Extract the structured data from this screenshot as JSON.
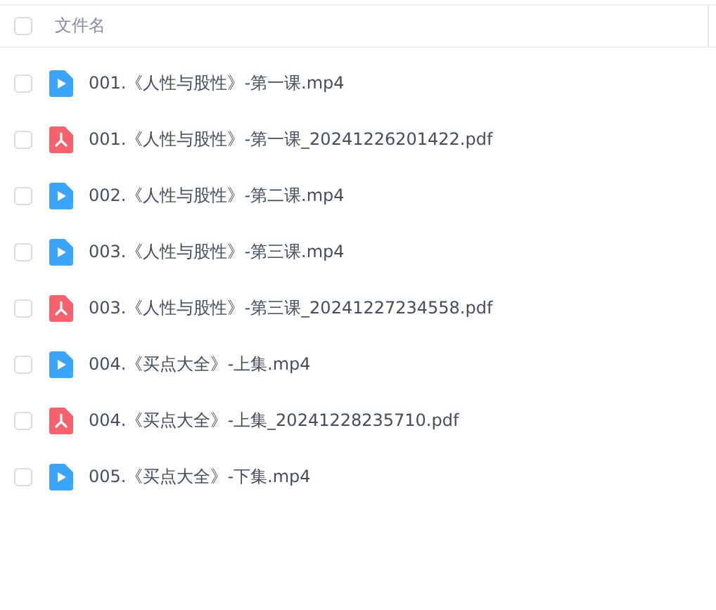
{
  "table": {
    "header": {
      "label": "文件名",
      "checked": false
    },
    "rows": [
      {
        "kind": "video",
        "name": "001.《人性与股性》-第一课.mp4",
        "checked": false
      },
      {
        "kind": "pdf",
        "name": "001.《人性与股性》-第一课_20241226201422.pdf",
        "checked": false
      },
      {
        "kind": "video",
        "name": "002.《人性与股性》-第二课.mp4",
        "checked": false
      },
      {
        "kind": "video",
        "name": "003.《人性与股性》-第三课.mp4",
        "checked": false
      },
      {
        "kind": "pdf",
        "name": "003.《人性与股性》-第三课_20241227234558.pdf",
        "checked": false
      },
      {
        "kind": "video",
        "name": "004.《买点大全》-上集.mp4",
        "checked": false
      },
      {
        "kind": "pdf",
        "name": "004.《买点大全》-上集_20241228235710.pdf",
        "checked": false
      },
      {
        "kind": "video",
        "name": "005.《买点大全》-下集.mp4",
        "checked": false
      }
    ]
  }
}
